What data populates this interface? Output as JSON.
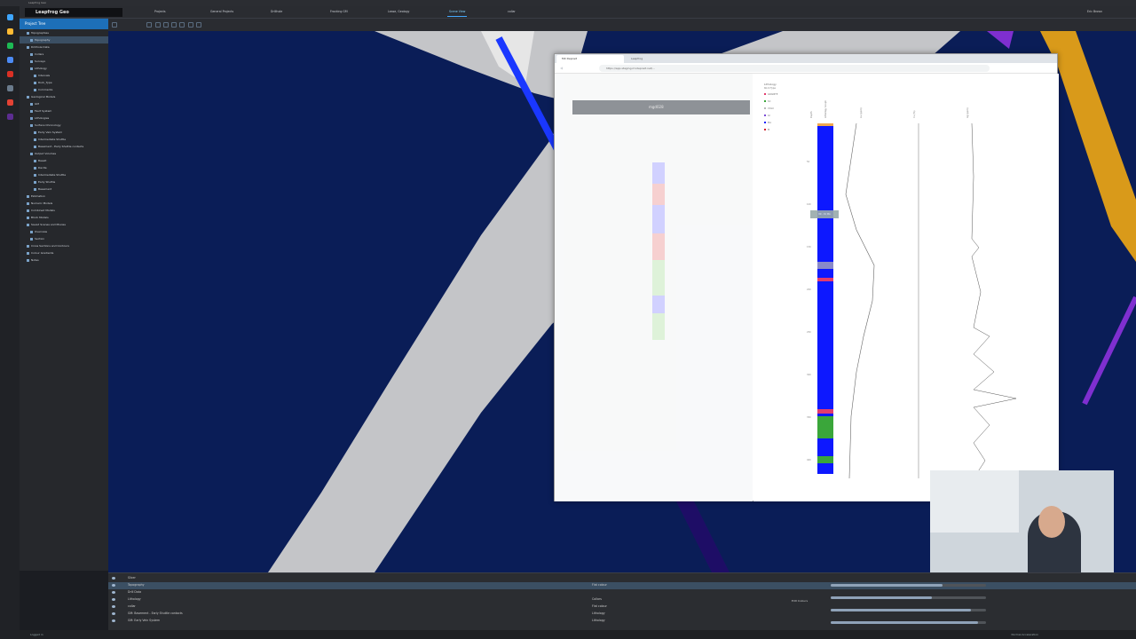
{
  "window": {
    "title": "Leapfrog Geo"
  },
  "app": {
    "logo": "Leapfrog Geo",
    "user": "Eric Brown"
  },
  "tabs": [
    {
      "label": "Projects"
    },
    {
      "label": "General Projects"
    },
    {
      "label": "Drillhole"
    },
    {
      "label": "Fracking GM"
    },
    {
      "label": "Lease, Geology"
    },
    {
      "label": "Scene View"
    },
    {
      "label": "collar"
    }
  ],
  "sidebar": {
    "header": "Project Tree",
    "items": [
      "Topographies",
      "Topography",
      "Drillhole Data",
      "Collars",
      "Surveys",
      "Lithology",
      "Intervals",
      "Rock_Type",
      "Comments",
      "Geological Models",
      "GM",
      "Fault System",
      "Lithologies",
      "Surface Chronology",
      "Early Vein System",
      "Intermediate Shuttle",
      "Basement - Early Shuttle contacts",
      "Output Volumes",
      "Basalt",
      "Dacite",
      "Intermediate Shuttle",
      "Early Shuttle",
      "Basement",
      "Estimation",
      "Numeric Models",
      "Combined Models",
      "Block Models",
      "Saved Scenes and Movies",
      "Overview",
      "Section",
      "Cross Sections and Contours",
      "Colour Gradients",
      "Notes"
    ]
  },
  "browser": {
    "tab1": "MX Deposit",
    "tab2": "Leapfrog",
    "url": "https://app.staging.mxdeposit.net/...",
    "hole_id": "mgd028",
    "lithology_label": "Lithology",
    "rock_type_label": "Rock Type",
    "legend": [
      {
        "name": "GRANITE",
        "color": "#e23b6d"
      },
      {
        "name": "SC",
        "color": "#3aa63a"
      },
      {
        "name": "VOLC",
        "color": "#b9b9b9"
      },
      {
        "name": "GI",
        "color": "#7b4bd6"
      },
      {
        "name": "MA",
        "color": "#1c24ff"
      },
      {
        "name": "M",
        "color": "#d1242f"
      }
    ],
    "column_headers": [
      "Depth",
      "Lithology Graph",
      "Au (ppm)",
      "Cu (%)",
      "Ag (ppm)"
    ],
    "depth_ticks": [
      "50",
      "100",
      "150",
      "200",
      "250",
      "300",
      "350",
      "400"
    ],
    "tooltip": "89 - 91 MA"
  },
  "lower_panel": {
    "rows": [
      {
        "name": "Slicer",
        "mid": ""
      },
      {
        "name": "Topography",
        "mid": "Flat colour"
      },
      {
        "name": "Drill Data",
        "mid": ""
      },
      {
        "name": "Lithology",
        "mid": "Collars"
      },
      {
        "name": "collar",
        "mid": "Flat colour"
      },
      {
        "name": "GM: Basement - Early Shuttle contacts",
        "mid": "Lithology"
      },
      {
        "name": "GM: Early Vein System",
        "mid": "Lithology"
      }
    ],
    "edit_button": "Edit Colours",
    "sliders": [
      0.72,
      0.65,
      0.9,
      0.95
    ]
  },
  "status": {
    "left": "Logged in",
    "right": "Normal Acceleration"
  },
  "colors": {
    "scene_bg": "#0a1d57",
    "accent": "#44a9ff",
    "lith_main": "#0d18ff"
  }
}
